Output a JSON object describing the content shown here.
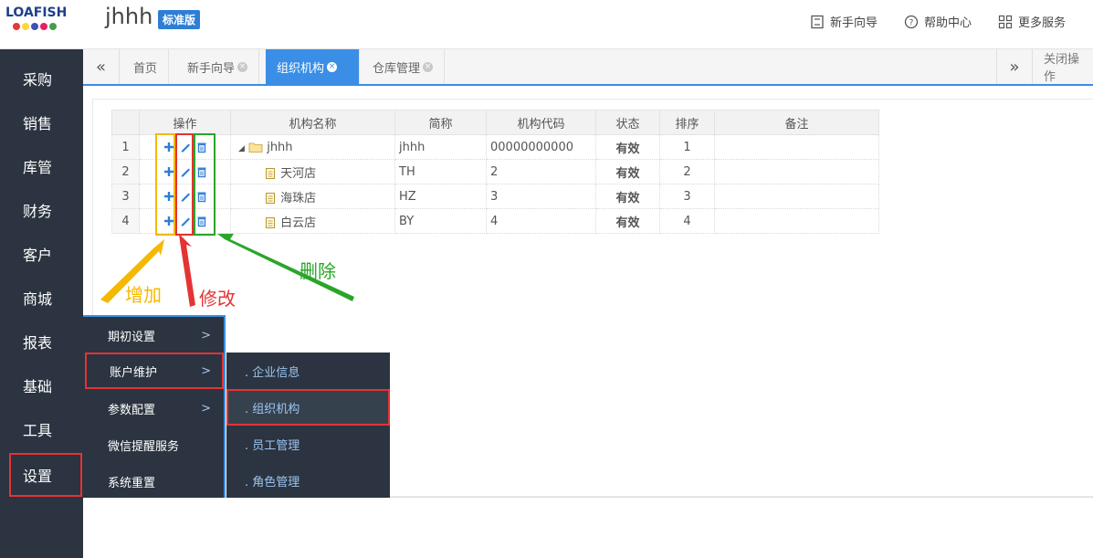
{
  "header": {
    "logo_text": "LOAFISH",
    "logo_dot_colors": [
      "#e53935",
      "#fdd835",
      "#3f51b5",
      "#e91e63",
      "#43a047"
    ],
    "company": "jhhh",
    "edition": "标准版",
    "links": [
      {
        "label": "新手向导",
        "icon": "guide-icon"
      },
      {
        "label": "帮助中心",
        "icon": "help-circle-icon"
      },
      {
        "label": "更多服务",
        "icon": "grid-icon"
      }
    ]
  },
  "sidebar": {
    "items": [
      "采购",
      "销售",
      "库管",
      "财务",
      "客户",
      "商城",
      "报表",
      "基础",
      "工具",
      "设置"
    ],
    "active": "设置"
  },
  "tabs": {
    "prev_icon": "double-chevron-left-icon",
    "next_icon": "double-chevron-right-icon",
    "items": [
      {
        "label": "首页",
        "closable": false
      },
      {
        "label": "新手向导",
        "closable": true
      },
      {
        "label": "组织机构",
        "closable": true,
        "active": true
      },
      {
        "label": "仓库管理",
        "closable": true
      }
    ],
    "close_ops": "关闭操作"
  },
  "grid": {
    "columns": [
      "操作",
      "机构名称",
      "简称",
      "机构代码",
      "状态",
      "排序",
      "备注"
    ],
    "rows": [
      {
        "no": "1",
        "name": "jhhh",
        "short": "jhhh",
        "code": "00000000000",
        "status": "有效",
        "order": "1",
        "note": "",
        "type": "folder"
      },
      {
        "no": "2",
        "name": "天河店",
        "short": "TH",
        "code": "2",
        "status": "有效",
        "order": "2",
        "note": "",
        "type": "file"
      },
      {
        "no": "3",
        "name": "海珠店",
        "short": "HZ",
        "code": "3",
        "status": "有效",
        "order": "3",
        "note": "",
        "type": "file"
      },
      {
        "no": "4",
        "name": "白云店",
        "short": "BY",
        "code": "4",
        "status": "有效",
        "order": "4",
        "note": "",
        "type": "file"
      }
    ]
  },
  "annotations": {
    "add": "增加",
    "edit": "修改",
    "delete": "删除",
    "colors": {
      "add": "#f5b800",
      "edit": "#e53333",
      "delete": "#2aa52a"
    }
  },
  "menu_level1": [
    {
      "label": "期初设置",
      "arrow": ">"
    },
    {
      "label": "账户维护",
      "arrow": ">",
      "selected": true
    },
    {
      "label": "参数配置",
      "arrow": ">"
    },
    {
      "label": "微信提醒服务",
      "arrow": ""
    },
    {
      "label": "系统重置",
      "arrow": ""
    }
  ],
  "menu_level2": [
    {
      "label": ". 企业信息"
    },
    {
      "label": ". 组织机构",
      "selected": true
    },
    {
      "label": ". 员工管理"
    },
    {
      "label": ". 角色管理"
    }
  ]
}
